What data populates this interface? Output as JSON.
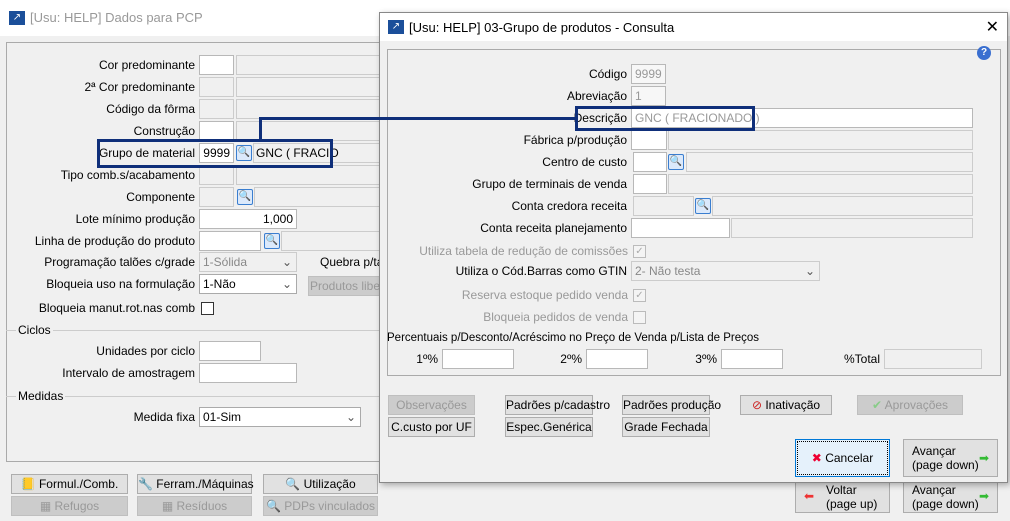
{
  "back": {
    "title": "[Usu: HELP] Dados para PCP",
    "fields": {
      "cor": "Cor predominante",
      "cor2": "2ª Cor predominante",
      "forma": "Código da fôrma",
      "construcao": "Construção",
      "grupo": "Grupo de material",
      "grupo_code": "9999",
      "grupo_desc": "GNC ( FRACIO",
      "tipo": "Tipo comb.s/acabamento",
      "componente": "Componente",
      "lote": "Lote mínimo produção",
      "lote_value": "1,000",
      "linha": "Linha de produção do produto",
      "programacao": "Programação talões c/grade",
      "programacao_value": "1-Sólida",
      "quebra": "Quebra p/ta",
      "bloqueia_uso": "Bloqueia uso na formulação",
      "bloqueia_uso_value": "1-Não",
      "produtos": "Produtos libe",
      "bloqueia_manut": "Bloqueia manut.rot.nas comb"
    },
    "ciclos": {
      "legend": "Ciclos",
      "unidades": "Unidades por ciclo",
      "intervalo": "Intervalo de amostragem"
    },
    "medidas": {
      "legend": "Medidas",
      "medida_fixa": "Medida fixa",
      "medida_fixa_value": "01-Sim"
    },
    "buttons": [
      "Formul./Comb.",
      "Ferram./Máquinas",
      "Utilização",
      "Refugos",
      "Resíduos",
      "PDPs vinculados"
    ],
    "voltar": [
      "Voltar",
      "(page up)"
    ],
    "avancar": [
      "Avançar",
      "(page down)"
    ]
  },
  "dialog": {
    "title": "[Usu: HELP] 03-Grupo de produtos - Consulta",
    "close": "✕",
    "codigo": "Código",
    "codigo_value": "9999",
    "abreviacao": "Abreviação",
    "abreviacao_value": "1",
    "descricao": "Descrição",
    "descricao_value": "GNC ( FRACIONADO )",
    "fabrica": "Fábrica p/produção",
    "centro": "Centro de custo",
    "terminais": "Grupo de terminais de venda",
    "credora": "Conta credora receita",
    "planejamento": "Conta receita planejamento",
    "utiliza_tabela": "Utiliza tabela de redução de comissões",
    "utiliza_tabela_checked": true,
    "gtin": "Utiliza o Cód.Barras como GTIN",
    "gtin_value": "2- Não testa",
    "reserva": "Reserva estoque pedido venda",
    "reserva_checked": true,
    "bloqueia": "Bloqueia pedidos de venda",
    "bloqueia_checked": false,
    "percentuais": "Percentuais p/Desconto/Acréscimo no Preço de Venda p/Lista de Preços",
    "p1": "1º%",
    "p2": "2º%",
    "p3": "3º%",
    "total": "%Total",
    "buttons": {
      "observacoes": "Observações",
      "padroes_cadastro": "Padrões p/cadastro",
      "padroes_producao": "Padrões produção",
      "inativacao": "Inativação",
      "aprovacoes": "Aprovações",
      "ccusto": "C.custo por UF",
      "espec": "Espec.Genérica",
      "grade": "Grade Fechada"
    },
    "cancelar": "Cancelar",
    "avancar": [
      "Avançar",
      "(page down)"
    ]
  },
  "colors": {
    "highlight": "#0f2f7a",
    "accent": "#1b4f9a"
  }
}
